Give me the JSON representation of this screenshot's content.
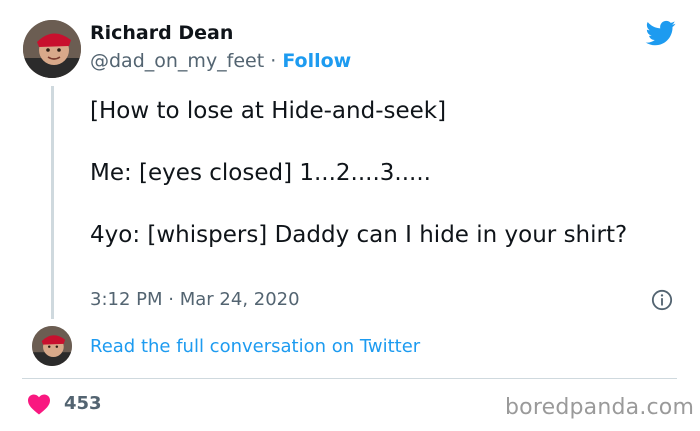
{
  "author": {
    "name": "Richard Dean",
    "handle": "@dad_on_my_feet",
    "separator": "·",
    "follow_label": "Follow"
  },
  "tweet": {
    "lines": [
      "[How to lose at Hide-and-seek]",
      "Me: [eyes closed] 1...2....3.....",
      "4yo: [whispers] Daddy can I hide in your shirt?"
    ],
    "time": "3:12 PM",
    "separator": "·",
    "date": "Mar 24, 2020"
  },
  "footer": {
    "read_link": "Read the full conversation on Twitter",
    "likes": "453"
  },
  "watermark": "boredpanda.com",
  "icons": {
    "brand": "twitter-bird-icon",
    "info": "info-icon",
    "like": "heart-icon"
  },
  "colors": {
    "accent": "#1d9bf0",
    "like": "#f91880",
    "text": "#0f1419",
    "muted": "#536471"
  }
}
